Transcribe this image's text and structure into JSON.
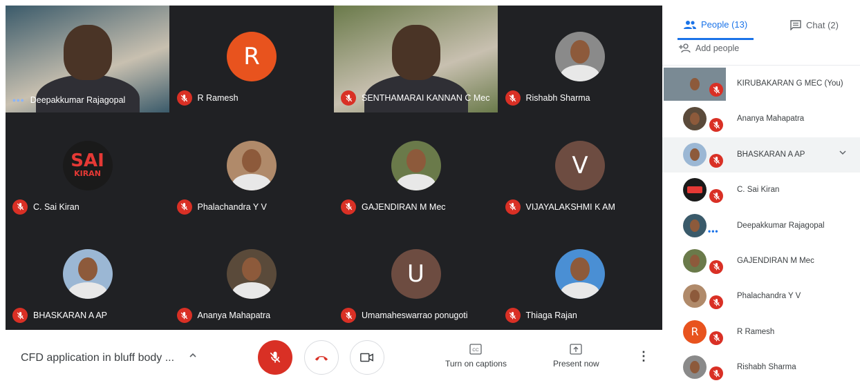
{
  "meeting": {
    "title": "CFD application in bluff body ...",
    "chevron": "^"
  },
  "tiles": [
    {
      "name": "Deepakkumar Rajagopal",
      "kind": "video",
      "muted": false,
      "speaking": true,
      "bg": "#3a5a6a"
    },
    {
      "name": "R Ramesh",
      "kind": "letter",
      "letter": "R",
      "color": "#e8531e",
      "muted": true
    },
    {
      "name": "SENTHAMARAI KANNAN C Mec",
      "kind": "video",
      "muted": true,
      "bg": "#6a7a4a"
    },
    {
      "name": "Rishabh Sharma",
      "kind": "photo",
      "color": "#8a8a8a",
      "muted": true
    },
    {
      "name": "C. Sai Kiran",
      "kind": "logo",
      "logo_text": "SAI",
      "logo_sub": "KIRAN",
      "color": "#1a1a1a",
      "muted": true
    },
    {
      "name": "Phalachandra Y V",
      "kind": "photo",
      "color": "#b08a6a",
      "muted": true
    },
    {
      "name": "GAJENDIRAN M Mec",
      "kind": "photo",
      "color": "#6a7a4a",
      "muted": true
    },
    {
      "name": "VIJAYALAKSHMI K AM",
      "kind": "letter",
      "letter": "V",
      "color": "#6d4c41",
      "muted": true
    },
    {
      "name": "BHASKARAN A AP",
      "kind": "photo",
      "color": "#9bb7d4",
      "muted": true
    },
    {
      "name": "Ananya Mahapatra",
      "kind": "photo",
      "color": "#5a4a3a",
      "muted": true
    },
    {
      "name": "Umamaheswarrao ponugoti",
      "kind": "letter",
      "letter": "U",
      "color": "#6d4c41",
      "muted": true
    },
    {
      "name": "Thiaga Rajan",
      "kind": "photo",
      "color": "#4a8fd4",
      "muted": true
    }
  ],
  "controls": {
    "captions_label": "Turn on captions",
    "present_label": "Present now",
    "more": "⋮"
  },
  "panel": {
    "people_tab": "People (13)",
    "chat_tab": "Chat (2)",
    "add_people": "Add people",
    "people": [
      {
        "name": "KIRUBAKARAN G MEC (You)",
        "kind": "video",
        "color": "#7a8a94",
        "muted": true
      },
      {
        "name": "Ananya Mahapatra",
        "kind": "photo",
        "color": "#5a4a3a",
        "muted": true
      },
      {
        "name": "BHASKARAN A AP",
        "kind": "photo",
        "color": "#9bb7d4",
        "muted": true,
        "selected": true
      },
      {
        "name": "C. Sai Kiran",
        "kind": "logo",
        "color": "#1a1a1a",
        "muted": true
      },
      {
        "name": "Deepakkumar Rajagopal",
        "kind": "photo",
        "color": "#3a5a6a",
        "muted": false,
        "speaking": true
      },
      {
        "name": "GAJENDIRAN M Mec",
        "kind": "photo",
        "color": "#6a7a4a",
        "muted": true
      },
      {
        "name": "Phalachandra Y V",
        "kind": "photo",
        "color": "#b08a6a",
        "muted": true
      },
      {
        "name": "R Ramesh",
        "kind": "letter",
        "letter": "R",
        "color": "#e8531e",
        "muted": true
      },
      {
        "name": "Rishabh Sharma",
        "kind": "photo",
        "color": "#8a8a8a",
        "muted": true
      }
    ]
  },
  "colors": {
    "accent": "#1a73e8",
    "mute_red": "#d93025",
    "grid_bg": "#202124"
  }
}
